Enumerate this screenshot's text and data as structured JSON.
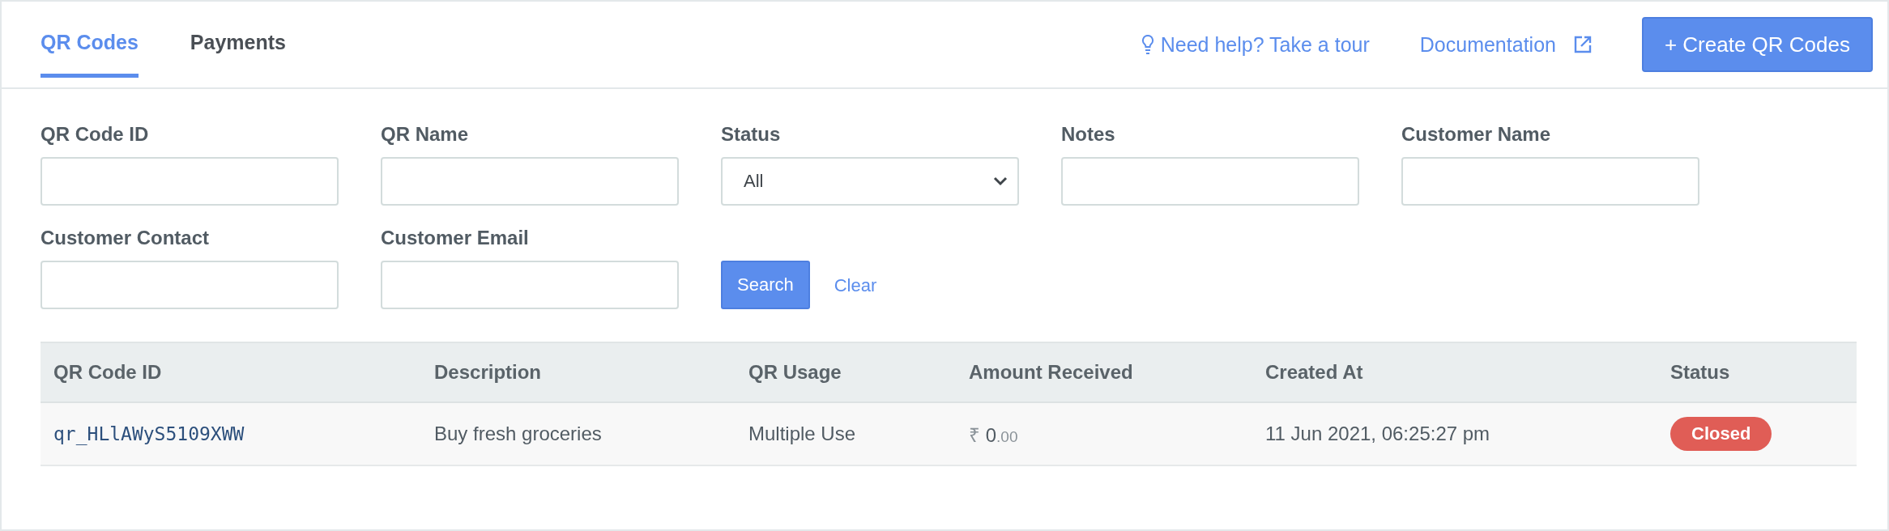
{
  "tabs": [
    {
      "label": "QR Codes",
      "selected": true
    },
    {
      "label": "Payments",
      "selected": false
    }
  ],
  "header_links": [
    {
      "label": "Need help? Take a tour",
      "kind": "tour"
    },
    {
      "label": "Documentation",
      "kind": "external"
    }
  ],
  "create_button": {
    "label": "+ Create QR Codes"
  },
  "filters": [
    {
      "label": "QR Code ID",
      "kind": "text"
    },
    {
      "label": "QR Name",
      "kind": "text"
    },
    {
      "label": "Status",
      "kind": "select",
      "value": "All"
    },
    {
      "label": "Notes",
      "kind": "text"
    },
    {
      "label": "Customer Name",
      "kind": "text"
    },
    {
      "label": "Customer Contact",
      "kind": "text"
    },
    {
      "label": "Customer Email",
      "kind": "text"
    }
  ],
  "search_button": "Search",
  "clear_link": "Clear",
  "table": {
    "columns": [
      "QR Code ID",
      "Description",
      "QR Usage",
      "Amount Received",
      "Created At",
      "Status"
    ],
    "rows": [
      {
        "id": "qr_HLlAWyS5109XWW",
        "description": "Buy fresh groceries",
        "usage": "Multiple Use",
        "amount": {
          "currency": "₹",
          "whole": "0",
          "fraction": ".00"
        },
        "created_at": "11 Jun 2021, 06:25:27 pm",
        "status": {
          "label": "Closed",
          "color": "#e05d56"
        }
      }
    ]
  }
}
